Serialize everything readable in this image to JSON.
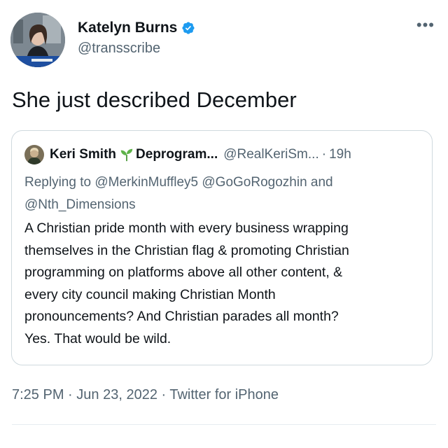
{
  "tweet": {
    "author": {
      "display_name": "Katelyn Burns",
      "handle": "@transscribe",
      "verified_icon": "verified-badge-icon",
      "verified_color": "#1d9bf0"
    },
    "more_label": "•••",
    "text": "She just described December",
    "quoted": {
      "display_name": "Keri Smith",
      "display_name_suffix": "Deprogram...",
      "sprout_icon": "seedling-icon",
      "handle": "@RealKeriSm...",
      "separator": "·",
      "time": "19h",
      "replying_prefix": "Replying to ",
      "replying_mentions": "@MerkinMuffley5 @GoGoRogozhin and @Nth_Dimensions",
      "body_lines": [
        "A Christian pride month with every business wrapping",
        "themselves in the Christian flag & promoting Christian",
        "programming on platforms above all other content, &",
        "every city council making Christian Month",
        "pronouncements? And Christian parades all month?",
        "Yes. That would be wild."
      ]
    },
    "meta": {
      "time": "7:25 PM",
      "date": "Jun 23, 2022",
      "source": "Twitter for iPhone",
      "separator": "·"
    }
  },
  "colors": {
    "text_primary": "#0f1419",
    "text_secondary": "#536471",
    "border": "#cfd9de",
    "accent": "#1d9bf0"
  }
}
